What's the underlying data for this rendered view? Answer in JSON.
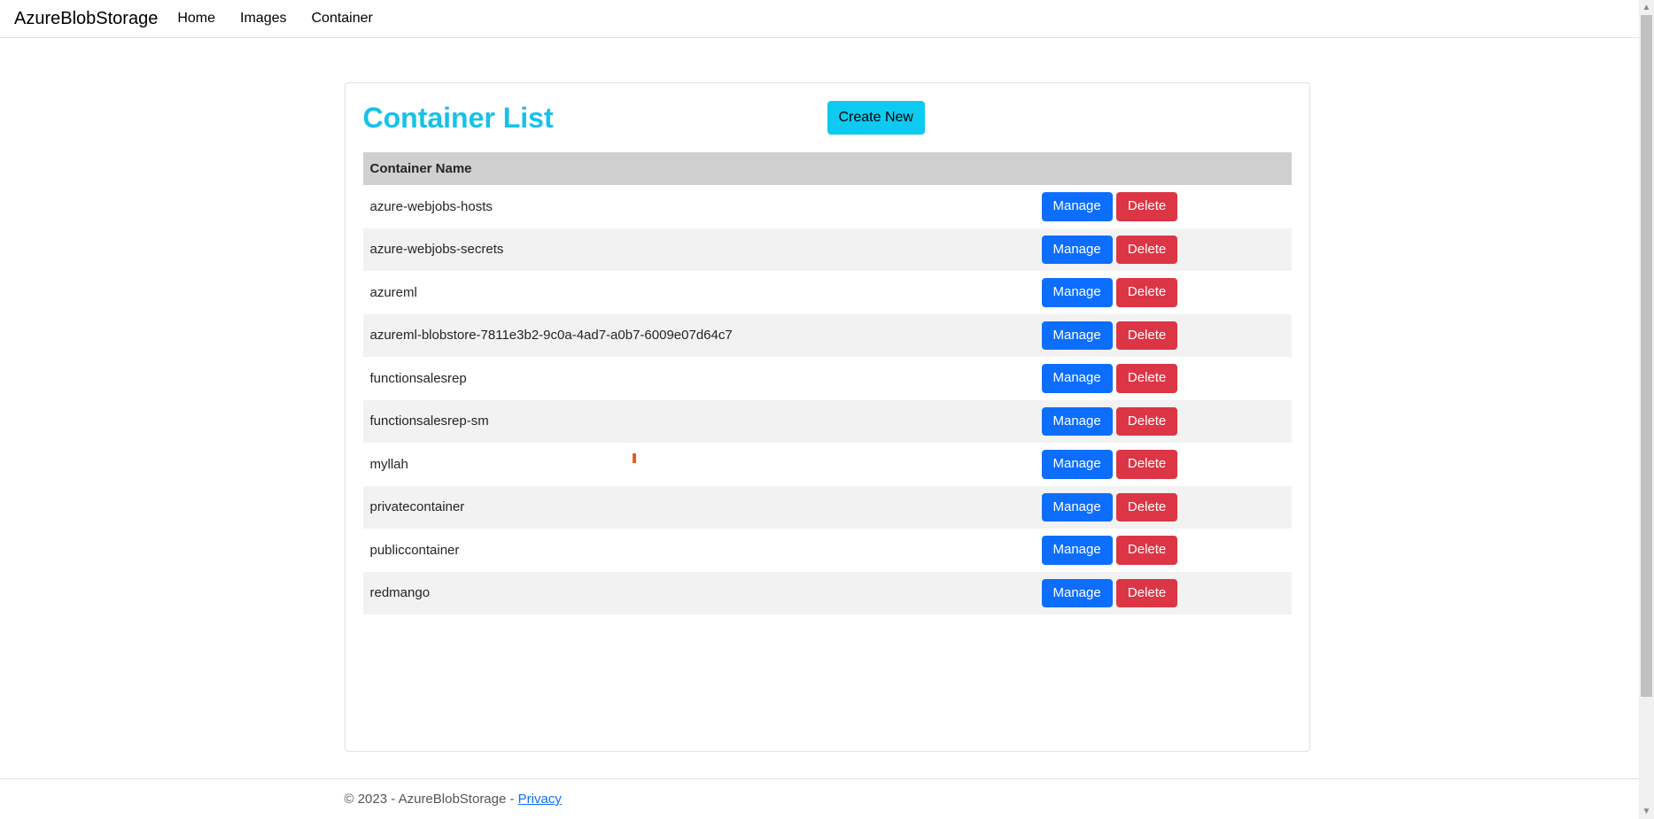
{
  "nav": {
    "brand": "AzureBlobStorage",
    "links": [
      {
        "label": "Home"
      },
      {
        "label": "Images"
      },
      {
        "label": "Container"
      }
    ]
  },
  "page": {
    "title": "Container List",
    "create_button": "Create New"
  },
  "table": {
    "header": "Container Name",
    "manage_label": "Manage",
    "delete_label": "Delete",
    "rows": [
      {
        "name": "azure-webjobs-hosts"
      },
      {
        "name": "azure-webjobs-secrets"
      },
      {
        "name": "azureml"
      },
      {
        "name": "azureml-blobstore-7811e3b2-9c0a-4ad7-a0b7-6009e07d64c7"
      },
      {
        "name": "functionsalesrep"
      },
      {
        "name": "functionsalesrep-sm"
      },
      {
        "name": "myllah"
      },
      {
        "name": "privatecontainer"
      },
      {
        "name": "publiccontainer"
      },
      {
        "name": "redmango"
      }
    ]
  },
  "footer": {
    "text": "© 2023 - AzureBlobStorage - ",
    "privacy": "Privacy"
  }
}
